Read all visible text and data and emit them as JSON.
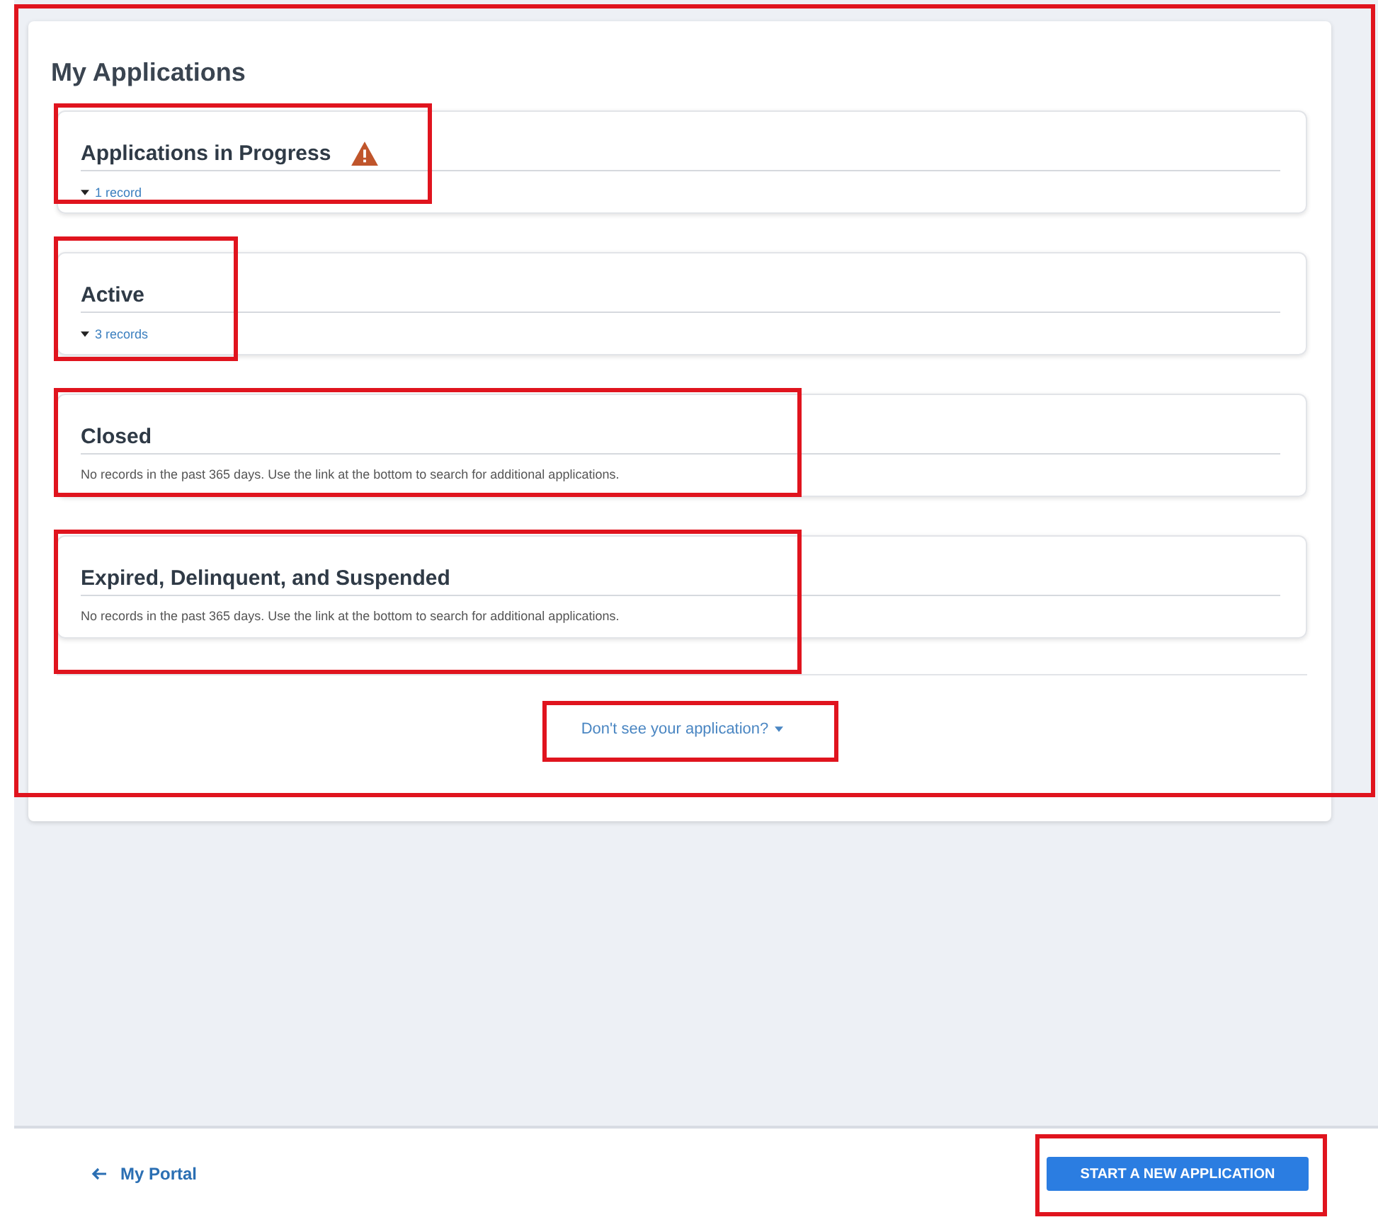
{
  "panel": {
    "title": "My Applications",
    "highlighted": true
  },
  "sections": [
    {
      "title": "Applications in Progress",
      "warning": true,
      "kind": "records",
      "text": "1 record",
      "highlighted": true
    },
    {
      "title": "Active",
      "warning": false,
      "kind": "records",
      "text": "3 records",
      "highlighted": true
    },
    {
      "title": "Closed",
      "warning": false,
      "kind": "message",
      "text": "No records in the past 365 days. Use the link at the bottom to search for additional applications.",
      "highlighted": true
    },
    {
      "title": "Expired, Delinquent, and Suspended",
      "warning": false,
      "kind": "message",
      "text": "No records in the past 365 days. Use the link at the bottom to search for additional applications.",
      "highlighted": true
    }
  ],
  "help_link": {
    "label": "Don't see your application?",
    "highlighted": true
  },
  "footer": {
    "back_link": "My Portal",
    "button": {
      "label": "START A NEW APPLICATION",
      "highlighted": true
    }
  }
}
